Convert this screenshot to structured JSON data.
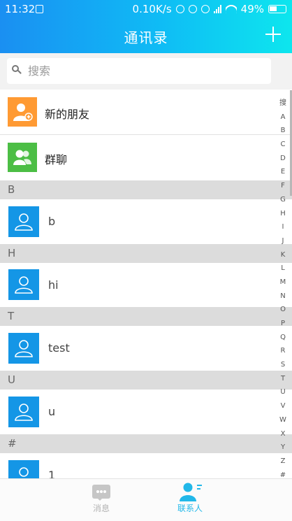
{
  "status_bar": {
    "time": "11:32",
    "speed": "0.10K/s",
    "battery": "49%"
  },
  "header": {
    "title": "通讯录"
  },
  "search": {
    "placeholder": "搜索"
  },
  "top_items": [
    {
      "label": "新的朋友",
      "icon": "new-friend-icon",
      "color": "#ff9a33"
    },
    {
      "label": "群聊",
      "icon": "group-chat-icon",
      "color": "#4cbe45"
    }
  ],
  "sections": [
    {
      "letter": "B",
      "contacts": [
        {
          "name": "b"
        }
      ]
    },
    {
      "letter": "H",
      "contacts": [
        {
          "name": "hi"
        }
      ]
    },
    {
      "letter": "T",
      "contacts": [
        {
          "name": "test"
        }
      ]
    },
    {
      "letter": "U",
      "contacts": [
        {
          "name": "u"
        }
      ]
    },
    {
      "letter": "#",
      "contacts": [
        {
          "name": "1"
        }
      ]
    }
  ],
  "index_letters": [
    "搜",
    "A",
    "B",
    "C",
    "D",
    "E",
    "F",
    "G",
    "H",
    "I",
    "J",
    "K",
    "L",
    "M",
    "N",
    "O",
    "P",
    "Q",
    "R",
    "S",
    "T",
    "U",
    "V",
    "W",
    "X",
    "Y",
    "Z",
    "#"
  ],
  "bottom_nav": [
    {
      "label": "消息",
      "icon": "chat-bubble-icon",
      "active": false
    },
    {
      "label": "联系人",
      "icon": "contacts-icon",
      "active": true
    }
  ],
  "colors": {
    "header_start": "#1a8ff2",
    "header_end": "#0de6ee",
    "avatar": "#1496e6",
    "active_tab": "#22b8e9"
  }
}
